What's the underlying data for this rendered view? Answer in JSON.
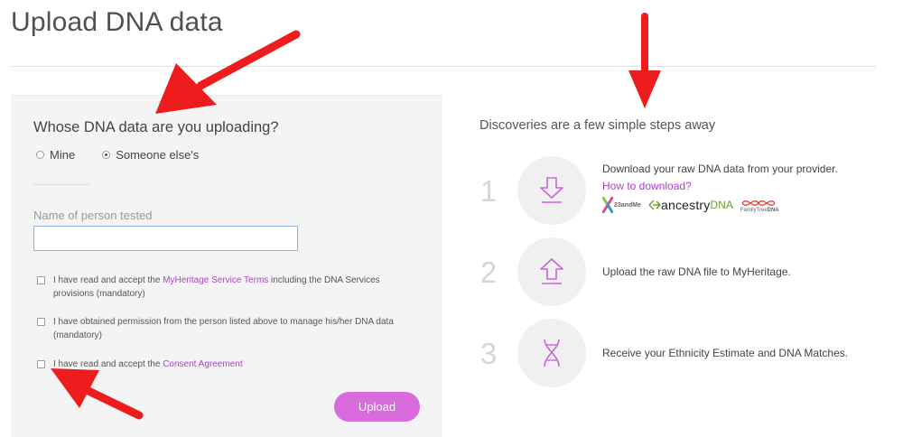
{
  "page": {
    "title": "Upload DNA data"
  },
  "form": {
    "heading": "Whose DNA data are you uploading?",
    "radios": [
      {
        "label": "Mine",
        "checked": false
      },
      {
        "label": "Someone else's",
        "checked": true
      }
    ],
    "name_label": "Name of person tested",
    "name_value": "",
    "terms": {
      "prefix": "I have read and accept the ",
      "link": "MyHeritage Service Terms",
      "suffix": " including the DNA Services provisions (mandatory)"
    },
    "permission": {
      "text": "I have obtained permission from the person listed above to manage his/her DNA data (mandatory)"
    },
    "consent": {
      "prefix": "I have read and accept the ",
      "link": "Consent Agreement"
    },
    "upload_label": "Upload"
  },
  "steps": {
    "heading": "Discoveries are a few simple steps away",
    "items": [
      {
        "number": "1",
        "icon": "download-arrow-icon",
        "text": "Download your raw DNA data from your provider.",
        "link": "How to download?"
      },
      {
        "number": "2",
        "icon": "upload-arrow-icon",
        "text": "Upload the raw DNA file to MyHeritage."
      },
      {
        "number": "3",
        "icon": "dna-helix-icon",
        "text": "Receive your Ethnicity Estimate and DNA Matches."
      }
    ],
    "providers": {
      "twentythree": "23andMe",
      "ancestry_a": "ancestry",
      "ancestry_b": "DNA",
      "ftdna_a": "FamilyTree",
      "ftdna_b": "DNA"
    }
  },
  "colors": {
    "accent": "#d96bdd",
    "link": "#b13bd6",
    "annotation_arrow": "#ee1c1c",
    "panel_bg": "#f4f4f4"
  }
}
